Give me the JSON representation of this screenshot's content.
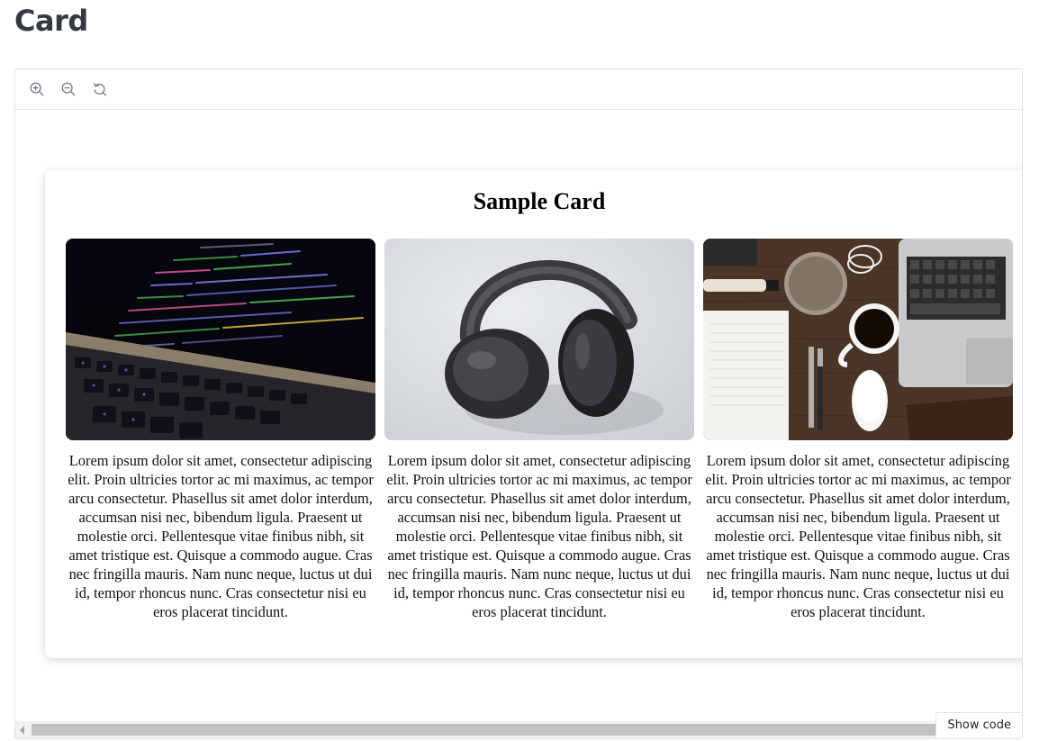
{
  "page": {
    "title": "Card"
  },
  "toolbar": {
    "icons": [
      "zoom-in-icon",
      "zoom-out-icon",
      "reset-icon"
    ]
  },
  "card": {
    "title": "Sample Card",
    "items": [
      {
        "image": "laptop-code-photo",
        "text": "Lorem ipsum dolor sit amet, consectetur adipiscing elit. Proin ultricies tortor ac mi maximus, ac tempor arcu consectetur. Phasellus sit amet dolor interdum, accumsan nisi nec, bibendum ligula. Praesent ut molestie orci. Pellentesque vitae finibus nibh, sit amet tristique est. Quisque a commodo augue. Cras nec fringilla mauris. Nam nunc neque, luctus ut dui id, tempor rhoncus nunc. Cras consectetur nisi eu eros placerat tincidunt."
      },
      {
        "image": "headphones-photo",
        "text": "Lorem ipsum dolor sit amet, consectetur adipiscing elit. Proin ultricies tortor ac mi maximus, ac tempor arcu consectetur. Phasellus sit amet dolor interdum, accumsan nisi nec, bibendum ligula. Praesent ut molestie orci. Pellentesque vitae finibus nibh, sit amet tristique est. Quisque a commodo augue. Cras nec fringilla mauris. Nam nunc neque, luctus ut dui id, tempor rhoncus nunc. Cras consectetur nisi eu eros placerat tincidunt."
      },
      {
        "image": "desk-flatlay-photo",
        "text": "Lorem ipsum dolor sit amet, consectetur adipiscing elit. Proin ultricies tortor ac mi maximus, ac tempor arcu consectetur. Phasellus sit amet dolor interdum, accumsan nisi nec, bibendum ligula. Praesent ut molestie orci. Pellentesque vitae finibus nibh, sit amet tristique est. Quisque a commodo augue. Cras nec fringilla mauris. Nam nunc neque, luctus ut dui id, tempor rhoncus nunc. Cras consectetur nisi eu eros placerat tincidunt."
      }
    ]
  },
  "footer": {
    "show_code_label": "Show code"
  },
  "colors": {
    "title_text": "#343a40",
    "border": "#dfe2e6",
    "icon": "#6c757d",
    "scroll_thumb": "#c1c1c1"
  }
}
